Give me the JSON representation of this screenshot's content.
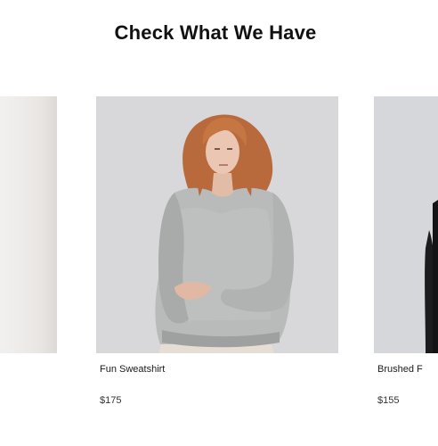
{
  "section": {
    "title": "Check What We Have"
  },
  "products": [
    {
      "name": "",
      "price": ""
    },
    {
      "name": "Fun Sweatshirt",
      "price": "$175"
    },
    {
      "name": "Brushed F",
      "price": "$155"
    }
  ],
  "colors": {
    "text": "#111111",
    "photo_background": "#d6d6d9"
  }
}
